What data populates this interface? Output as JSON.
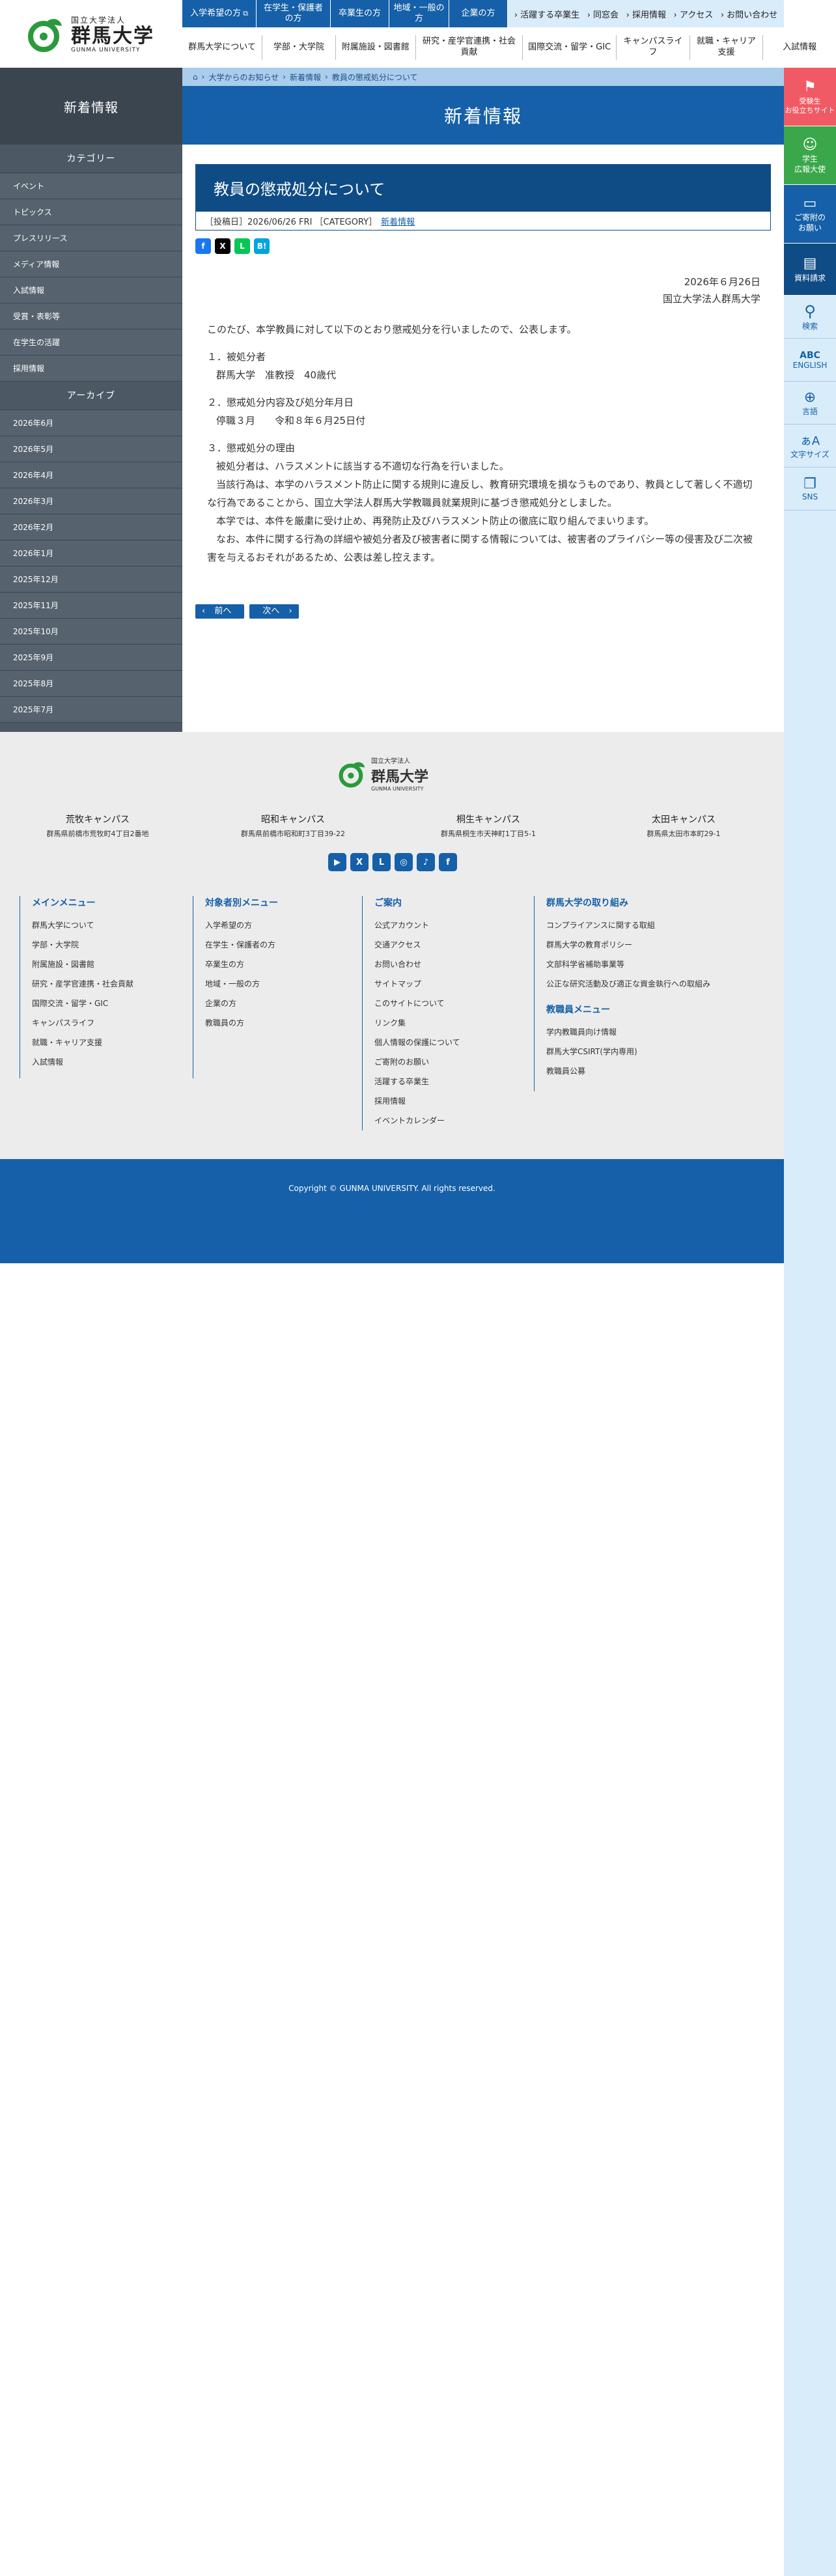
{
  "logo": {
    "line1": "国立大学法人",
    "line2": "群馬大学",
    "line3": "GUNMA UNIVERSITY"
  },
  "top_buttons": [
    "入学希望の方",
    "在学生・保護者の方",
    "卒業生の方",
    "地域・一般の方",
    "企業の方"
  ],
  "top_links": [
    "活躍する卒業生",
    "同窓会",
    "採用情報",
    "アクセス",
    "お問い合わせ"
  ],
  "main_nav": [
    "群馬大学について",
    "学部・大学院",
    "附属施設・図書館",
    "研究・産学官連携・社会貢献",
    "国際交流・留学・GIC",
    "キャンパスライフ",
    "就職・キャリア支援",
    "入試情報"
  ],
  "sidebar": {
    "title": "新着情報",
    "cat_head": "カテゴリー",
    "categories": [
      "イベント",
      "トピックス",
      "プレスリリース",
      "メディア情報",
      "入試情報",
      "受賞・表彰等",
      "在学生の活躍",
      "採用情報"
    ],
    "arch_head": "アーカイブ",
    "archives": [
      "2026年6月",
      "2026年5月",
      "2026年4月",
      "2026年3月",
      "2026年2月",
      "2026年1月",
      "2025年12月",
      "2025年11月",
      "2025年10月",
      "2025年9月",
      "2025年8月",
      "2025年7月"
    ]
  },
  "breadcrumb": [
    "大学からのお知らせ",
    "新着情報",
    "教員の懲戒処分について"
  ],
  "banner": "新着情報",
  "article": {
    "title": "教員の懲戒処分について",
    "meta": "［投稿日］2026/06/26 FRI ［CATEGORY］",
    "category": "新着情報",
    "date": "2026年６月26日",
    "org": "国立大学法人群馬大学",
    "intro": "このたび、本学教員に対して以下のとおり懲戒処分を行いましたので、公表します。",
    "s1h": "１．被処分者",
    "s1b": "群馬大学　准教授　40歳代",
    "s2h": "２．懲戒処分内容及び処分年月日",
    "s2b": "停職３月　　令和８年６月25日付",
    "s3h": "３．懲戒処分の理由",
    "s3b1": "被処分者は、ハラスメントに該当する不適切な行為を行いました。",
    "s3b2": "当該行為は、本学のハラスメント防止に関する規則に違反し、教育研究環境を損なうものであり、教員として著しく不適切な行為であることから、国立大学法人群馬大学教職員就業規則に基づき懲戒処分としました。",
    "s3b3": "本学では、本件を厳粛に受け止め、再発防止及びハラスメント防止の徹底に取り組んでまいります。",
    "s3b4": "なお、本件に関する行為の詳細や被処分者及び被害者に関する情報については、被害者のプライバシー等の侵害及び二次被害を与えるおそれがあるため、公表は差し控えます。"
  },
  "pager": {
    "prev": "前へ",
    "next": "次へ"
  },
  "right_menu": {
    "b1": "受験生\nお役立ちサイト",
    "b2": "学生\n広報大使",
    "b3": "ご寄附の\nお願い",
    "b4": "資料請求",
    "i1": "検索",
    "i2": "ENGLISH",
    "i3": "言語",
    "i4": "文字サイズ",
    "i5": "SNS"
  },
  "footer": {
    "logo1": "国立大学法人",
    "logo2": "群馬大学",
    "logo3": "GUNMA UNIVERSITY",
    "campuses": [
      {
        "name": "荒牧キャンパス",
        "addr": "群馬県前橋市荒牧町4丁目2番地"
      },
      {
        "name": "昭和キャンパス",
        "addr": "群馬県前橋市昭和町3丁目39-22"
      },
      {
        "name": "桐生キャンパス",
        "addr": "群馬県桐生市天神町1丁目5-1"
      },
      {
        "name": "太田キャンパス",
        "addr": "群馬県太田市本町29-1"
      }
    ],
    "col1h": "メインメニュー",
    "col1": [
      "群馬大学について",
      "学部・大学院",
      "附属施設・図書館",
      "研究・産学官連携・社会貢献",
      "国際交流・留学・GIC",
      "キャンパスライフ",
      "就職・キャリア支援",
      "入試情報"
    ],
    "col2h": "対象者別メニュー",
    "col2": [
      "入学希望の方",
      "在学生・保護者の方",
      "卒業生の方",
      "地域・一般の方",
      "企業の方",
      "教職員の方"
    ],
    "col3h": "ご案内",
    "col3": [
      "公式アカウント",
      "交通アクセス",
      "お問い合わせ",
      "サイトマップ",
      "このサイトについて",
      "リンク集",
      "個人情報の保護について",
      "ご寄附のお願い",
      "活躍する卒業生",
      "採用情報",
      "イベントカレンダー"
    ],
    "col4h": "群馬大学の取り組み",
    "col4": [
      "コンプライアンスに関する取組",
      "群馬大学の教育ポリシー",
      "文部科学省補助事業等",
      "公正な研究活動及び適正な資金執行への取組み"
    ],
    "col5h": "教職員メニュー",
    "col5": [
      "学内教職員向け情報",
      "群馬大学CSIRT(学内専用)",
      "教職員公募"
    ],
    "copyright": "Copyright © GUNMA UNIVERSITY. All rights reserved."
  }
}
